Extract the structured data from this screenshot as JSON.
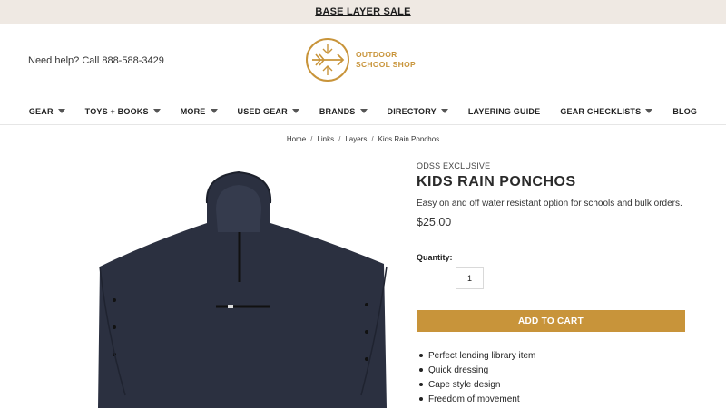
{
  "promo": {
    "label": "BASE LAYER SALE"
  },
  "header": {
    "help_text": "Need help? Call 888-588-3429",
    "logo_line1": "OUTDOOR",
    "logo_line2": "SCHOOL SHOP",
    "logo_icon": "compass-arrow-icon",
    "brand_color": "#c8943a"
  },
  "nav": [
    {
      "label": "GEAR",
      "caret": true
    },
    {
      "label": "TOYS + BOOKS",
      "caret": true
    },
    {
      "label": "MORE",
      "caret": true
    },
    {
      "label": "USED GEAR",
      "caret": true
    },
    {
      "label": "BRANDS",
      "caret": true
    },
    {
      "label": "DIRECTORY",
      "caret": true
    },
    {
      "label": "LAYERING GUIDE",
      "caret": false
    },
    {
      "label": "GEAR CHECKLISTS",
      "caret": true
    },
    {
      "label": "BLOG",
      "caret": false
    }
  ],
  "breadcrumb": [
    "Home",
    "Links",
    "Layers",
    "Kids Rain Ponchos"
  ],
  "product": {
    "brand": "ODSS EXCLUSIVE",
    "title": "KIDS RAIN PONCHOS",
    "description": "Easy on and off water resistant option for schools and bulk orders.",
    "price": "$25.00",
    "quantity_label": "Quantity:",
    "quantity_value": "1",
    "add_to_cart": "ADD TO CART",
    "features": [
      "Perfect lending library item",
      "Quick dressing",
      "Cape style design",
      "Freedom of movement"
    ],
    "image_color": "#2b3040"
  }
}
